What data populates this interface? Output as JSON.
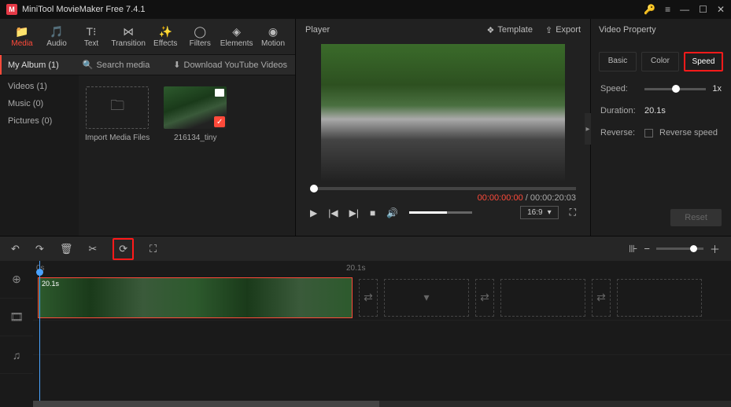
{
  "app": {
    "title": "MiniTool MovieMaker Free 7.4.1"
  },
  "tabs": {
    "media": "Media",
    "audio": "Audio",
    "text": "Text",
    "transition": "Transition",
    "effects": "Effects",
    "filters": "Filters",
    "elements": "Elements",
    "motion": "Motion"
  },
  "subbar": {
    "album": "My Album (1)",
    "search_placeholder": "Search media",
    "download": "Download YouTube Videos"
  },
  "side": {
    "videos": "Videos (1)",
    "music": "Music (0)",
    "pictures": "Pictures (0)"
  },
  "media": {
    "import": "Import Media Files",
    "item1": "216134_tiny"
  },
  "player": {
    "title": "Player",
    "template": "Template",
    "export": "Export",
    "time_current": "00:00:00:00",
    "time_total": "00:00:20:03",
    "ratio": "16:9"
  },
  "props": {
    "title": "Video Property",
    "tab_basic": "Basic",
    "tab_color": "Color",
    "tab_speed": "Speed",
    "speed_label": "Speed:",
    "speed_value": "1x",
    "duration_label": "Duration:",
    "duration_value": "20.1s",
    "reverse_label": "Reverse:",
    "reverse_check": "Reverse speed",
    "reset": "Reset"
  },
  "timeline": {
    "ruler_start": "0s",
    "ruler_mid": "20.1s",
    "clip_label": "20.1s"
  }
}
